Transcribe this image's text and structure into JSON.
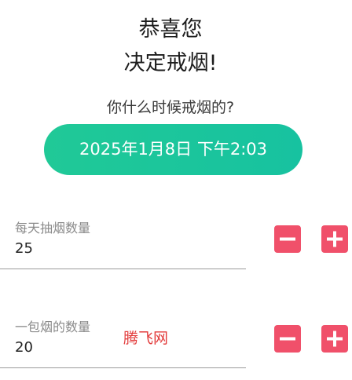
{
  "header": {
    "line1": "恭喜您",
    "line2": "决定戒烟!"
  },
  "question": "你什么时候戒烟的?",
  "date_button": {
    "label": "2025年1月8日 下午2:03"
  },
  "fields": [
    {
      "label": "每天抽烟数量",
      "value": "25"
    },
    {
      "label": "一包烟的数量",
      "value": "20"
    }
  ],
  "watermark": "腾飞网",
  "colors": {
    "accent": "#1ec59b",
    "stepper": "#f0506a",
    "watermark": "#e23a3a"
  },
  "icons": {
    "minus": "minus-icon",
    "plus": "plus-icon"
  }
}
